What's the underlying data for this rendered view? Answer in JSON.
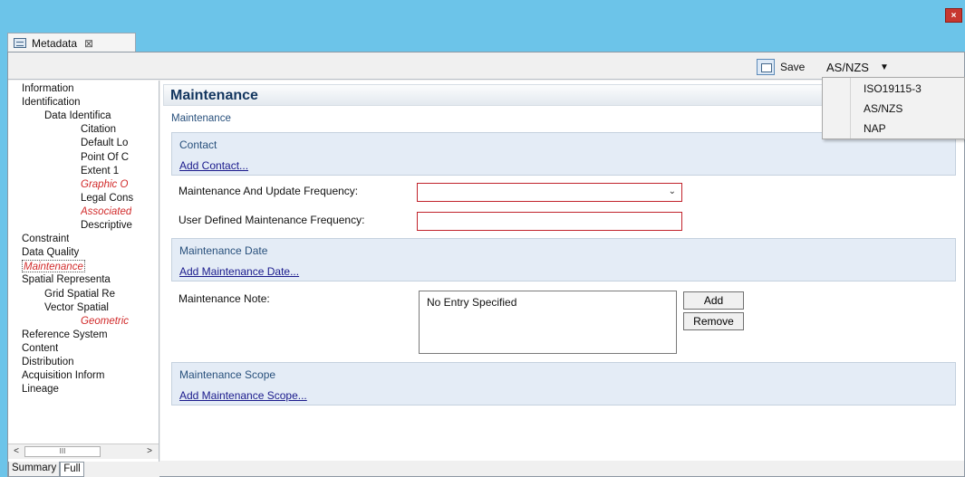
{
  "window": {
    "close_label": "×"
  },
  "tab": {
    "label": "Metadata",
    "close": "⊠"
  },
  "toolbar": {
    "save_label": "Save",
    "standard_value": "AS/NZS",
    "caret": "▼"
  },
  "standard_menu": {
    "options": [
      "ISO19115-3",
      "AS/NZS",
      "NAP"
    ]
  },
  "tree": {
    "items": [
      {
        "label": "Information",
        "level": 0,
        "style": "normal"
      },
      {
        "label": "Identification",
        "level": 0,
        "style": "normal"
      },
      {
        "label": "Data Identifica",
        "level": 1,
        "style": "normal"
      },
      {
        "label": "Citation",
        "level": 2,
        "style": "normal"
      },
      {
        "label": "Default Lo",
        "level": 2,
        "style": "normal"
      },
      {
        "label": "Point Of C",
        "level": 2,
        "style": "normal"
      },
      {
        "label": "Extent 1",
        "level": 2,
        "style": "normal"
      },
      {
        "label": "Graphic O",
        "level": 2,
        "style": "red"
      },
      {
        "label": "Legal Cons",
        "level": 2,
        "style": "normal"
      },
      {
        "label": "Associated",
        "level": 2,
        "style": "red"
      },
      {
        "label": "Descriptive",
        "level": 2,
        "style": "normal"
      },
      {
        "label": "Constraint",
        "level": 0,
        "style": "normal"
      },
      {
        "label": "Data Quality",
        "level": 0,
        "style": "normal"
      },
      {
        "label": "Maintenance",
        "level": 0,
        "style": "red-selected"
      },
      {
        "label": "Spatial Representa",
        "level": 0,
        "style": "normal"
      },
      {
        "label": "Grid Spatial Re",
        "level": 1,
        "style": "normal"
      },
      {
        "label": "Vector Spatial",
        "level": 1,
        "style": "normal"
      },
      {
        "label": "Geometric",
        "level": 2,
        "style": "red"
      },
      {
        "label": "Reference System",
        "level": 0,
        "style": "normal"
      },
      {
        "label": "Content",
        "level": 0,
        "style": "normal"
      },
      {
        "label": "Distribution",
        "level": 0,
        "style": "normal"
      },
      {
        "label": "Acquisition Inform",
        "level": 0,
        "style": "normal"
      },
      {
        "label": "Lineage",
        "level": 0,
        "style": "normal"
      }
    ],
    "scroll_left": "<",
    "scroll_right": ">",
    "scroll_thumb": "III"
  },
  "bottom_tabs": {
    "summary": "Summary",
    "full": "Full"
  },
  "main": {
    "heading": "Maintenance",
    "subheading": "Maintenance",
    "contact": {
      "title": "Contact",
      "link": "Add Contact..."
    },
    "frequency_label": "Maintenance And Update Frequency:",
    "frequency_value": "",
    "frequency_caret": "⌄",
    "user_frequency_label": "User Defined Maintenance Frequency:",
    "user_frequency_value": "",
    "maintenance_date": {
      "title": "Maintenance Date",
      "link": "Add Maintenance Date..."
    },
    "note_label": "Maintenance Note:",
    "note_value": "No Entry Specified",
    "add_button": "Add",
    "remove_button": "Remove",
    "maintenance_scope": {
      "title": "Maintenance Scope",
      "link": "Add Maintenance Scope..."
    }
  },
  "colors": {
    "frame": "#6cc4e9",
    "required_border": "#c1232b",
    "missing_text": "#d12b2b",
    "heading": "#13365f"
  }
}
